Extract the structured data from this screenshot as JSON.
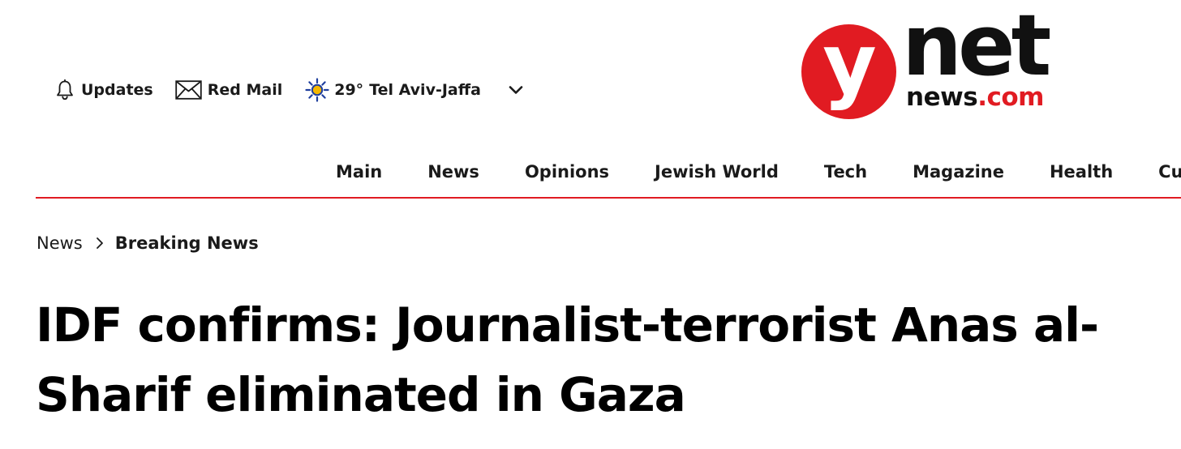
{
  "utility_bar": {
    "updates_label": "Updates",
    "mail_label": "Red Mail",
    "weather_temp": "29°",
    "weather_city": "Tel Aviv-Jaffa",
    "icons": [
      "bell-icon",
      "envelope-icon",
      "sun-icon",
      "chevron-down-icon"
    ]
  },
  "logo": {
    "letter": "y",
    "word": "net",
    "domain_name": "news",
    "domain_tld": ".com",
    "brand_red": "#e11b22"
  },
  "nav": {
    "items": [
      {
        "label": "Main"
      },
      {
        "label": "News"
      },
      {
        "label": "Opinions"
      },
      {
        "label": "Jewish World"
      },
      {
        "label": "Tech"
      },
      {
        "label": "Magazine"
      },
      {
        "label": "Health"
      },
      {
        "label": "Cultur"
      }
    ]
  },
  "breadcrumb": {
    "parent": "News",
    "current": "Breaking News"
  },
  "article": {
    "headline_line1": "IDF confirms: Journalist-terrorist Anas al-",
    "headline_line2": "Sharif eliminated in Gaza"
  },
  "colors": {
    "accent": "#e11b22",
    "text": "#111111",
    "weather_sun": "#f5b800",
    "weather_ray": "#1f3f9e"
  }
}
